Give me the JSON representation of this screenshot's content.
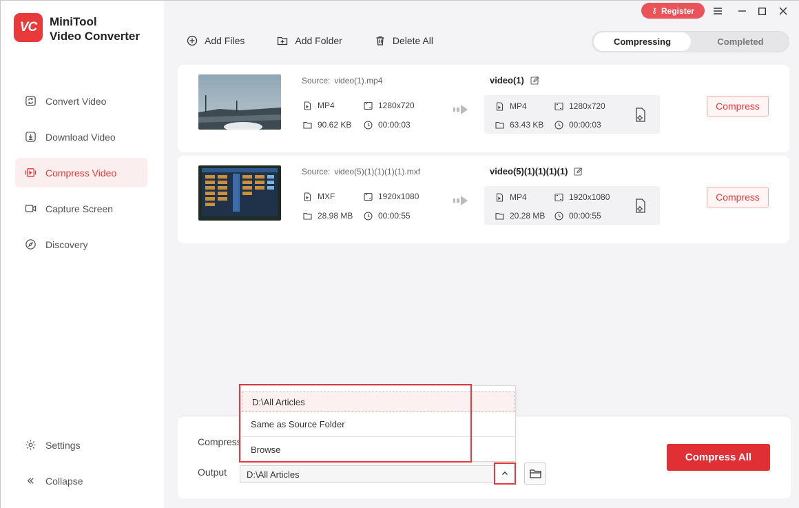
{
  "app": {
    "logo_text": "VC",
    "name_line1": "MiniTool",
    "name_line2": "Video Converter"
  },
  "colors": {
    "accent": "#e8393b",
    "sidebar_active_bg": "#fbeeee"
  },
  "nav": [
    {
      "label": "Convert Video",
      "icon": "convert-icon"
    },
    {
      "label": "Download Video",
      "icon": "download-icon"
    },
    {
      "label": "Compress Video",
      "icon": "compress-icon",
      "active": true
    },
    {
      "label": "Capture Screen",
      "icon": "camera-icon"
    },
    {
      "label": "Discovery",
      "icon": "compass-icon"
    }
  ],
  "bottom_nav": [
    {
      "label": "Settings",
      "icon": "gear-icon"
    },
    {
      "label": "Collapse",
      "icon": "collapse-icon"
    }
  ],
  "titlebar": {
    "register": "Register"
  },
  "toolbar": {
    "add_files": "Add Files",
    "add_folder": "Add Folder",
    "delete_all": "Delete All"
  },
  "tabs": {
    "compressing": "Compressing",
    "completed": "Completed"
  },
  "tasks": [
    {
      "source_label": "Source:",
      "source_file": "video(1).mp4",
      "in": {
        "format": "MP4",
        "resolution": "1280x720",
        "size": "90.62 KB",
        "duration": "00:00:03"
      },
      "output_name": "video(1)",
      "out": {
        "format": "MP4",
        "resolution": "1280x720",
        "size": "63.43 KB",
        "duration": "00:00:03"
      },
      "action": "Compress"
    },
    {
      "source_label": "Source:",
      "source_file": "video(5)(1)(1)(1)(1).mxf",
      "in": {
        "format": "MXF",
        "resolution": "1920x1080",
        "size": "28.98 MB",
        "duration": "00:00:55"
      },
      "output_name": "video(5)(1)(1)(1)(1)",
      "out": {
        "format": "MP4",
        "resolution": "1920x1080",
        "size": "20.28 MB",
        "duration": "00:00:55"
      },
      "action": "Compress"
    }
  ],
  "bottom": {
    "compress_label": "Compress",
    "output_label": "Output",
    "output_value": "D:\\All Articles",
    "compress_all": "Compress All"
  },
  "dropdown": {
    "options": [
      "D:\\All Articles",
      "Same as Source Folder",
      "Browse"
    ]
  }
}
